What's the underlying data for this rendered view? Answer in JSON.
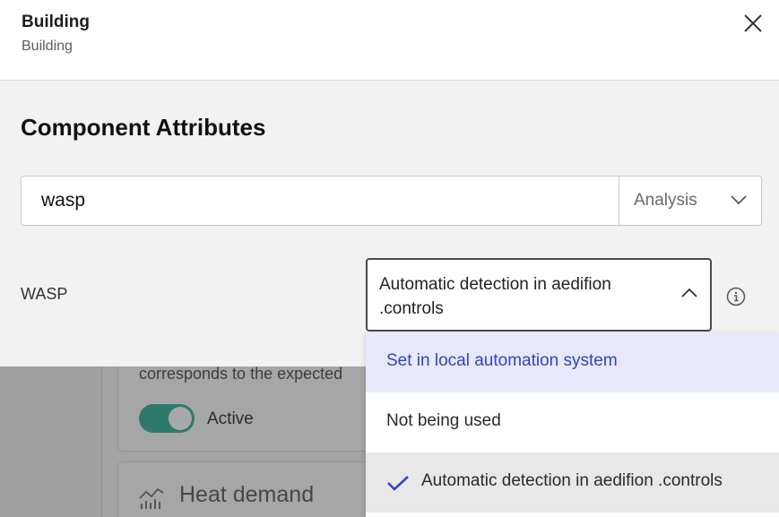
{
  "header": {
    "title": "Building",
    "subtitle": "Building"
  },
  "section": {
    "title": "Component Attributes"
  },
  "search": {
    "value": "wasp",
    "filter_label": "Analysis"
  },
  "attribute": {
    "label": "WASP",
    "selected_value": "Automatic detection in aedifion .controls"
  },
  "menu": {
    "options": [
      {
        "label": "Set in local automation system",
        "state": "hovered"
      },
      {
        "label": "Not being used",
        "state": "default"
      },
      {
        "label": "Automatic detection in aedifion .controls",
        "state": "selected"
      }
    ]
  },
  "background": {
    "card_text": "corresponds to the expected",
    "toggle_label": "Active",
    "card2_title": "Heat demand"
  },
  "icons": {
    "close": "close-icon",
    "chevron_down": "chevron-down-icon",
    "chevron_up": "chevron-up-icon",
    "info": "info-icon",
    "check": "check-icon",
    "chart": "chart-icon"
  },
  "colors": {
    "accent": "#3344bb",
    "hover_bg": "#e7e8fb",
    "selected_bg": "#e8e8e8",
    "toggle_on": "#2e7a6a"
  }
}
